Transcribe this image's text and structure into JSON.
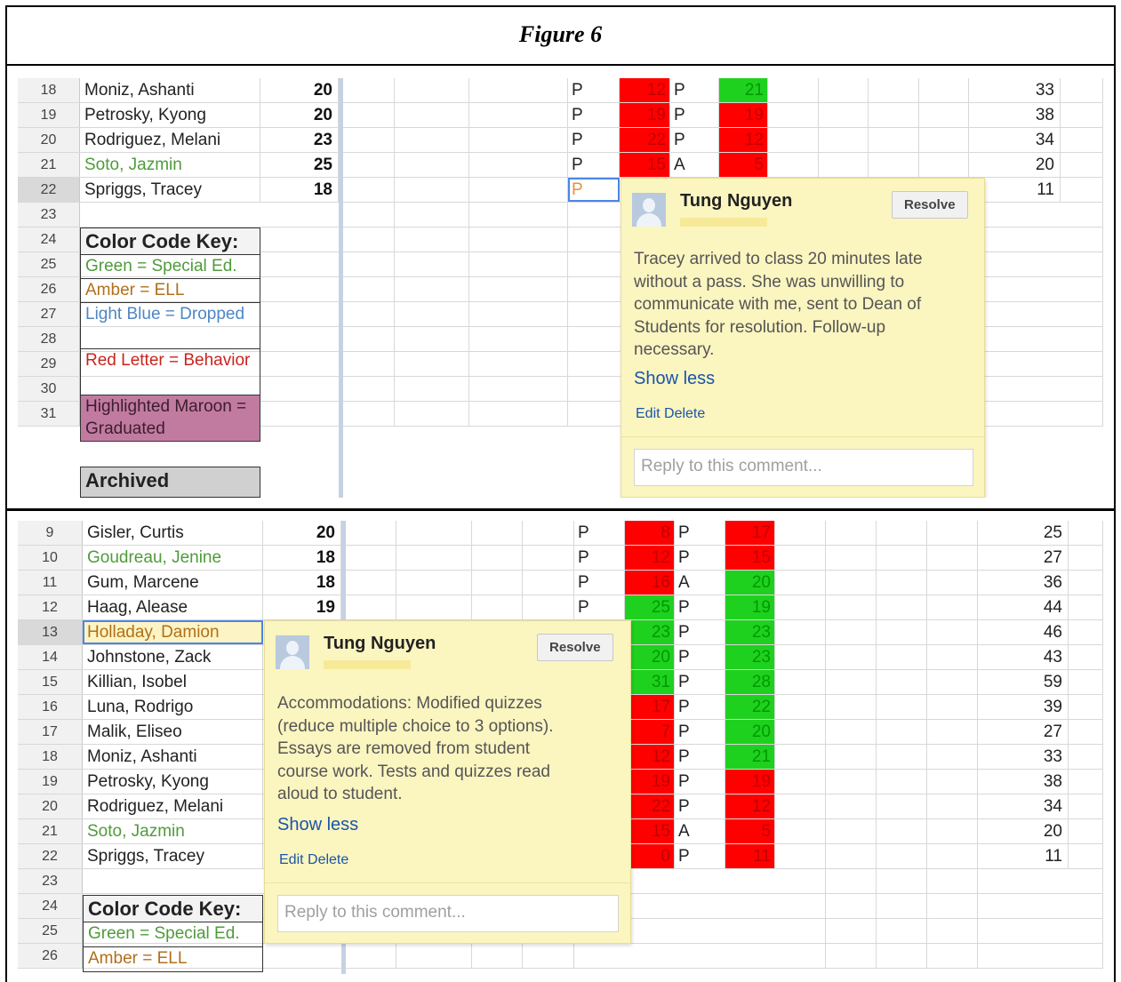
{
  "title": "Figure 6",
  "panel1": {
    "rows": [
      {
        "num": "18",
        "name": "Moniz, Ashanti",
        "color": "",
        "score": "20",
        "att1": "P",
        "v1": "12",
        "c1": "red",
        "att2": "P",
        "v2": "21",
        "c2": "green",
        "total": "33"
      },
      {
        "num": "19",
        "name": "Petrosky, Kyong",
        "color": "",
        "score": "20",
        "att1": "P",
        "v1": "19",
        "c1": "red",
        "att2": "P",
        "v2": "19",
        "c2": "red",
        "total": "38"
      },
      {
        "num": "20",
        "name": "Rodriguez, Melani",
        "color": "",
        "score": "23",
        "att1": "P",
        "v1": "22",
        "c1": "red",
        "att2": "P",
        "v2": "12",
        "c2": "red",
        "total": "34"
      },
      {
        "num": "21",
        "name": "Soto, Jazmin",
        "color": "green",
        "score": "25",
        "att1": "P",
        "v1": "15",
        "c1": "red",
        "att2": "A",
        "v2": "5",
        "c2": "red",
        "total": "20"
      },
      {
        "num": "22",
        "name": "Spriggs, Tracey",
        "color": "",
        "score": "18",
        "att1": "P",
        "v1": "",
        "c1": "",
        "att2": "",
        "v2": "",
        "c2": "",
        "total": "11"
      }
    ],
    "row_numbers_after": [
      "23",
      "24",
      "25",
      "26",
      "27",
      "28",
      "29",
      "30",
      "31"
    ],
    "key": {
      "title": "Color Code Key:",
      "green": "Green = Special Ed.",
      "amber": "Amber = ELL",
      "blue": "Light Blue = Dropped",
      "red": "Red Letter = Behavior",
      "maroon": "Highlighted Maroon = Graduated",
      "archived": "Archived"
    },
    "comment": {
      "author": "Tung Nguyen",
      "resolve": "Resolve",
      "text": "Tracey arrived to class 20 minutes late\nwithout a pass. She was unwilling to\ncommunicate with me, sent to Dean of\nStudents for resolution. Follow-up\nnecessary.",
      "show_less": "Show less",
      "edit_delete": "Edit Delete",
      "reply_placeholder": "Reply to this comment..."
    }
  },
  "panel2": {
    "rows": [
      {
        "num": "9",
        "name": "Gisler, Curtis",
        "color": "",
        "score": "20",
        "att1": "P",
        "v1": "8",
        "c1": "red",
        "att2": "P",
        "v2": "17",
        "c2": "red",
        "total": "25"
      },
      {
        "num": "10",
        "name": "Goudreau, Jenine",
        "color": "green",
        "score": "18",
        "att1": "P",
        "v1": "12",
        "c1": "red",
        "att2": "P",
        "v2": "15",
        "c2": "red",
        "total": "27"
      },
      {
        "num": "11",
        "name": "Gum, Marcene",
        "color": "",
        "score": "18",
        "att1": "P",
        "v1": "16",
        "c1": "red",
        "att2": "A",
        "v2": "20",
        "c2": "green",
        "total": "36"
      },
      {
        "num": "12",
        "name": "Haag, Alease",
        "color": "",
        "score": "19",
        "att1": "P",
        "v1": "25",
        "c1": "green",
        "att2": "P",
        "v2": "19",
        "c2": "green",
        "total": "44"
      },
      {
        "num": "13",
        "name": "Holladay, Damion",
        "color": "amber",
        "score": "",
        "att1": "",
        "v1": "23",
        "c1": "green",
        "att2": "P",
        "v2": "23",
        "c2": "green",
        "total": "46"
      },
      {
        "num": "14",
        "name": "Johnstone, Zack",
        "color": "",
        "score": "",
        "att1": "",
        "v1": "20",
        "c1": "green",
        "att2": "P",
        "v2": "23",
        "c2": "green",
        "total": "43"
      },
      {
        "num": "15",
        "name": "Killian, Isobel",
        "color": "",
        "score": "",
        "att1": "",
        "v1": "31",
        "c1": "green",
        "att2": "P",
        "v2": "28",
        "c2": "green",
        "total": "59"
      },
      {
        "num": "16",
        "name": "Luna, Rodrigo",
        "color": "",
        "score": "",
        "att1": "",
        "v1": "17",
        "c1": "red",
        "att2": "P",
        "v2": "22",
        "c2": "green",
        "total": "39"
      },
      {
        "num": "17",
        "name": "Malik, Eliseo",
        "color": "",
        "score": "",
        "att1": "",
        "v1": "7",
        "c1": "red",
        "att2": "P",
        "v2": "20",
        "c2": "green",
        "total": "27"
      },
      {
        "num": "18",
        "name": "Moniz, Ashanti",
        "color": "",
        "score": "",
        "att1": "",
        "v1": "12",
        "c1": "red",
        "att2": "P",
        "v2": "21",
        "c2": "green",
        "total": "33"
      },
      {
        "num": "19",
        "name": "Petrosky, Kyong",
        "color": "",
        "score": "",
        "att1": "",
        "v1": "19",
        "c1": "red",
        "att2": "P",
        "v2": "19",
        "c2": "red",
        "total": "38"
      },
      {
        "num": "20",
        "name": "Rodriguez, Melani",
        "color": "",
        "score": "",
        "att1": "",
        "v1": "22",
        "c1": "red",
        "att2": "P",
        "v2": "12",
        "c2": "red",
        "total": "34"
      },
      {
        "num": "21",
        "name": "Soto, Jazmin",
        "color": "green",
        "score": "",
        "att1": "",
        "v1": "15",
        "c1": "red",
        "att2": "A",
        "v2": "5",
        "c2": "red",
        "total": "20"
      },
      {
        "num": "22",
        "name": "Spriggs, Tracey",
        "color": "",
        "score": "",
        "att1": "",
        "v1": "0",
        "c1": "red",
        "att2": "P",
        "v2": "11",
        "c2": "red",
        "total": "11"
      }
    ],
    "row_numbers_after": [
      "23",
      "24",
      "25",
      "26"
    ],
    "key": {
      "title": "Color Code Key:",
      "green": "Green = Special Ed.",
      "amber": "Amber = ELL"
    },
    "comment": {
      "author": "Tung Nguyen",
      "resolve": "Resolve",
      "text": "Accommodations: Modified quizzes\n(reduce multiple choice to 3 options).\nEssays are removed from student\ncourse work. Tests and quizzes read\naloud to student.",
      "show_less": "Show less",
      "edit_delete": "Edit Delete",
      "reply_placeholder": "Reply to this comment..."
    }
  }
}
